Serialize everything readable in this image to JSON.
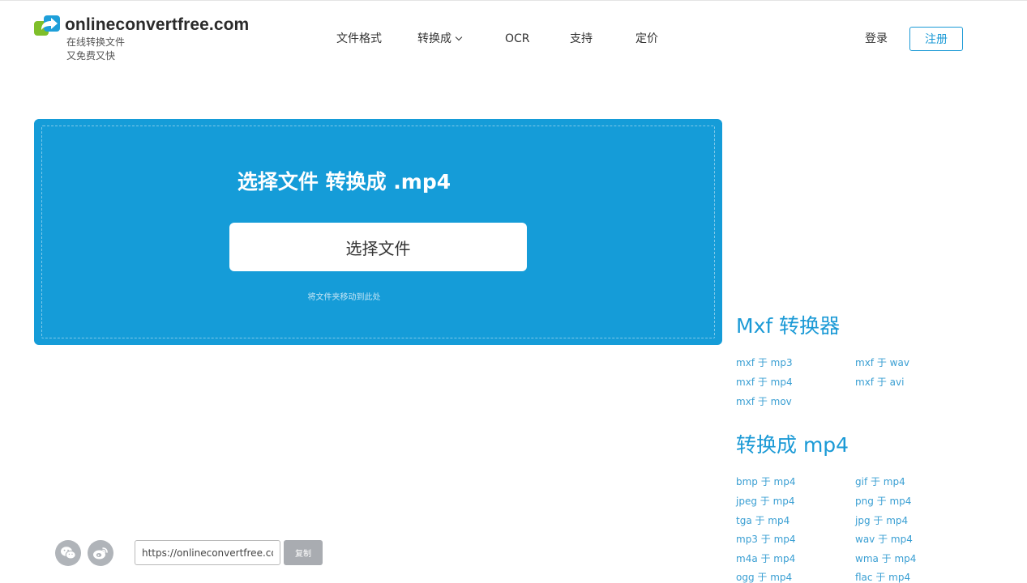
{
  "header": {
    "logo_title": "onlineconvertfree.com",
    "logo_sub_1": "在线转换文件",
    "logo_sub_2": "又免费又快",
    "nav": {
      "file_formats": "文件格式",
      "convert_to": "转换成",
      "ocr": "OCR",
      "support": "支持",
      "pricing": "定价"
    },
    "login": "登录",
    "register": "注册"
  },
  "upload": {
    "title": "选择文件 转换成 .mp4",
    "button": "选择文件",
    "drop_hint": "将文件夹移动到此处"
  },
  "mxf_section": {
    "title": "Mxf 转换器",
    "links": [
      "mxf 于 mp3",
      "mxf 于 wav",
      "mxf 于 mp4",
      "mxf 于 avi",
      "mxf 于 mov"
    ]
  },
  "mp4_section": {
    "title": "转换成 mp4",
    "links": [
      "bmp 于 mp4",
      "gif 于 mp4",
      "jpeg 于 mp4",
      "png 于 mp4",
      "tga 于 mp4",
      "jpg 于 mp4",
      "mp3 于 mp4",
      "wav 于 mp4",
      "m4a 于 mp4",
      "wma 于 mp4",
      "ogg 于 mp4",
      "flac 于 mp4"
    ]
  },
  "share": {
    "url_value": "https://onlineconvertfree.com",
    "copy": "复制"
  },
  "colors": {
    "accent": "#1b9ad6",
    "panel": "#159cd8",
    "social_gray": "#b0b4b9"
  },
  "icons": {
    "logo": "convert-arrow-logo-icon",
    "chevron": "chevron-down-icon",
    "wechat": "wechat-icon",
    "weibo": "weibo-icon"
  }
}
